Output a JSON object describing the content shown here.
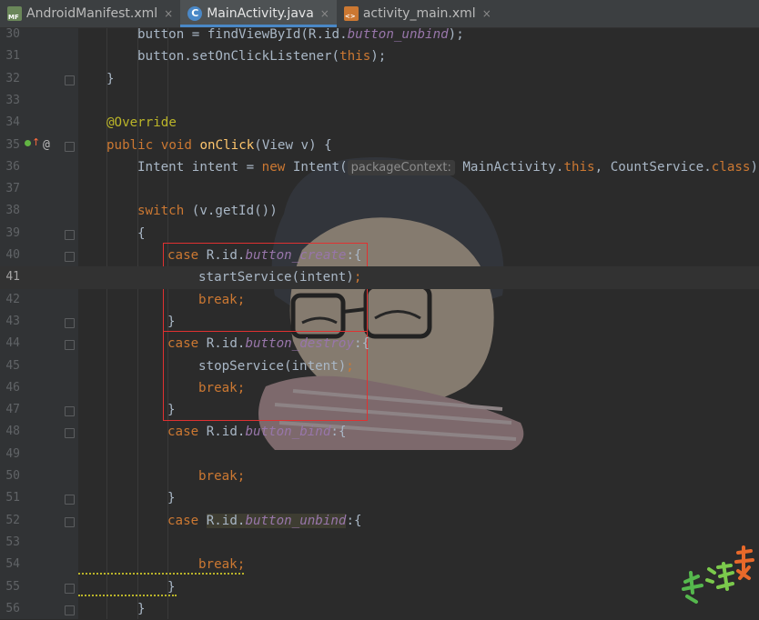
{
  "tabs": [
    {
      "label": "AndroidManifest.xml",
      "icon": "manifest-file-icon",
      "active": false
    },
    {
      "label": "MainActivity.java",
      "icon": "java-class-icon",
      "active": true
    },
    {
      "label": "activity_main.xml",
      "icon": "xml-file-icon",
      "active": false
    }
  ],
  "close_glyph": "×",
  "editor": {
    "current_line": "41",
    "hint_label": "packageContext:",
    "line_numbers": [
      "30",
      "31",
      "32",
      "33",
      "34",
      "35",
      "36",
      "37",
      "38",
      "39",
      "40",
      "41",
      "42",
      "43",
      "44",
      "45",
      "46",
      "47",
      "48",
      "49",
      "50",
      "51",
      "52",
      "53",
      "54",
      "55",
      "56"
    ],
    "code": {
      "l30a": "button = findViewById(R.id.",
      "l30b": "button_unbind",
      "l30c": ");",
      "l31a": "button.setOnClickListener(",
      "l31b": "this",
      "l31c": ");",
      "l32": "}",
      "l34": "@Override",
      "l35a": "public void ",
      "l35b": "onClick",
      "l35c": "(View v) {",
      "l36a": "Intent intent = ",
      "l36b": "new ",
      "l36c": "Intent(",
      "l36d": " MainActivity.",
      "l36e": "this",
      "l36f": ", CountService.",
      "l36g": "class",
      "l36h": ");",
      "l38a": "switch ",
      "l38b": "(v.getId())",
      "l39": "{",
      "l40a": "case ",
      "l40b": "R.id.",
      "l40c": "button_create",
      "l40d": ":{",
      "l41a": "startService(intent)",
      "l41b": ";",
      "l42": "break;",
      "l43": "}",
      "l44a": "case ",
      "l44b": "R.id.",
      "l44c": "button_destroy",
      "l44d": ":{",
      "l45a": "stopService(intent)",
      "l45b": ";",
      "l46": "break;",
      "l47": "}",
      "l48a": "case ",
      "l48b": "R.id.",
      "l48c": "button_bind",
      "l48d": ":{",
      "l50": "break;",
      "l51": "}",
      "l52a": "case ",
      "l52b": "R.id.",
      "l52c": "button_unbind",
      "l52d": ":{",
      "l54": "break;",
      "l55": "}",
      "l56": "}"
    }
  },
  "gutter_at": "@",
  "colors": {
    "keyword": "#cc7832",
    "field": "#9876aa",
    "method": "#ffc66d",
    "annotation": "#bbb529",
    "text": "#a9b7c6",
    "highlight_box": "#e03131"
  }
}
